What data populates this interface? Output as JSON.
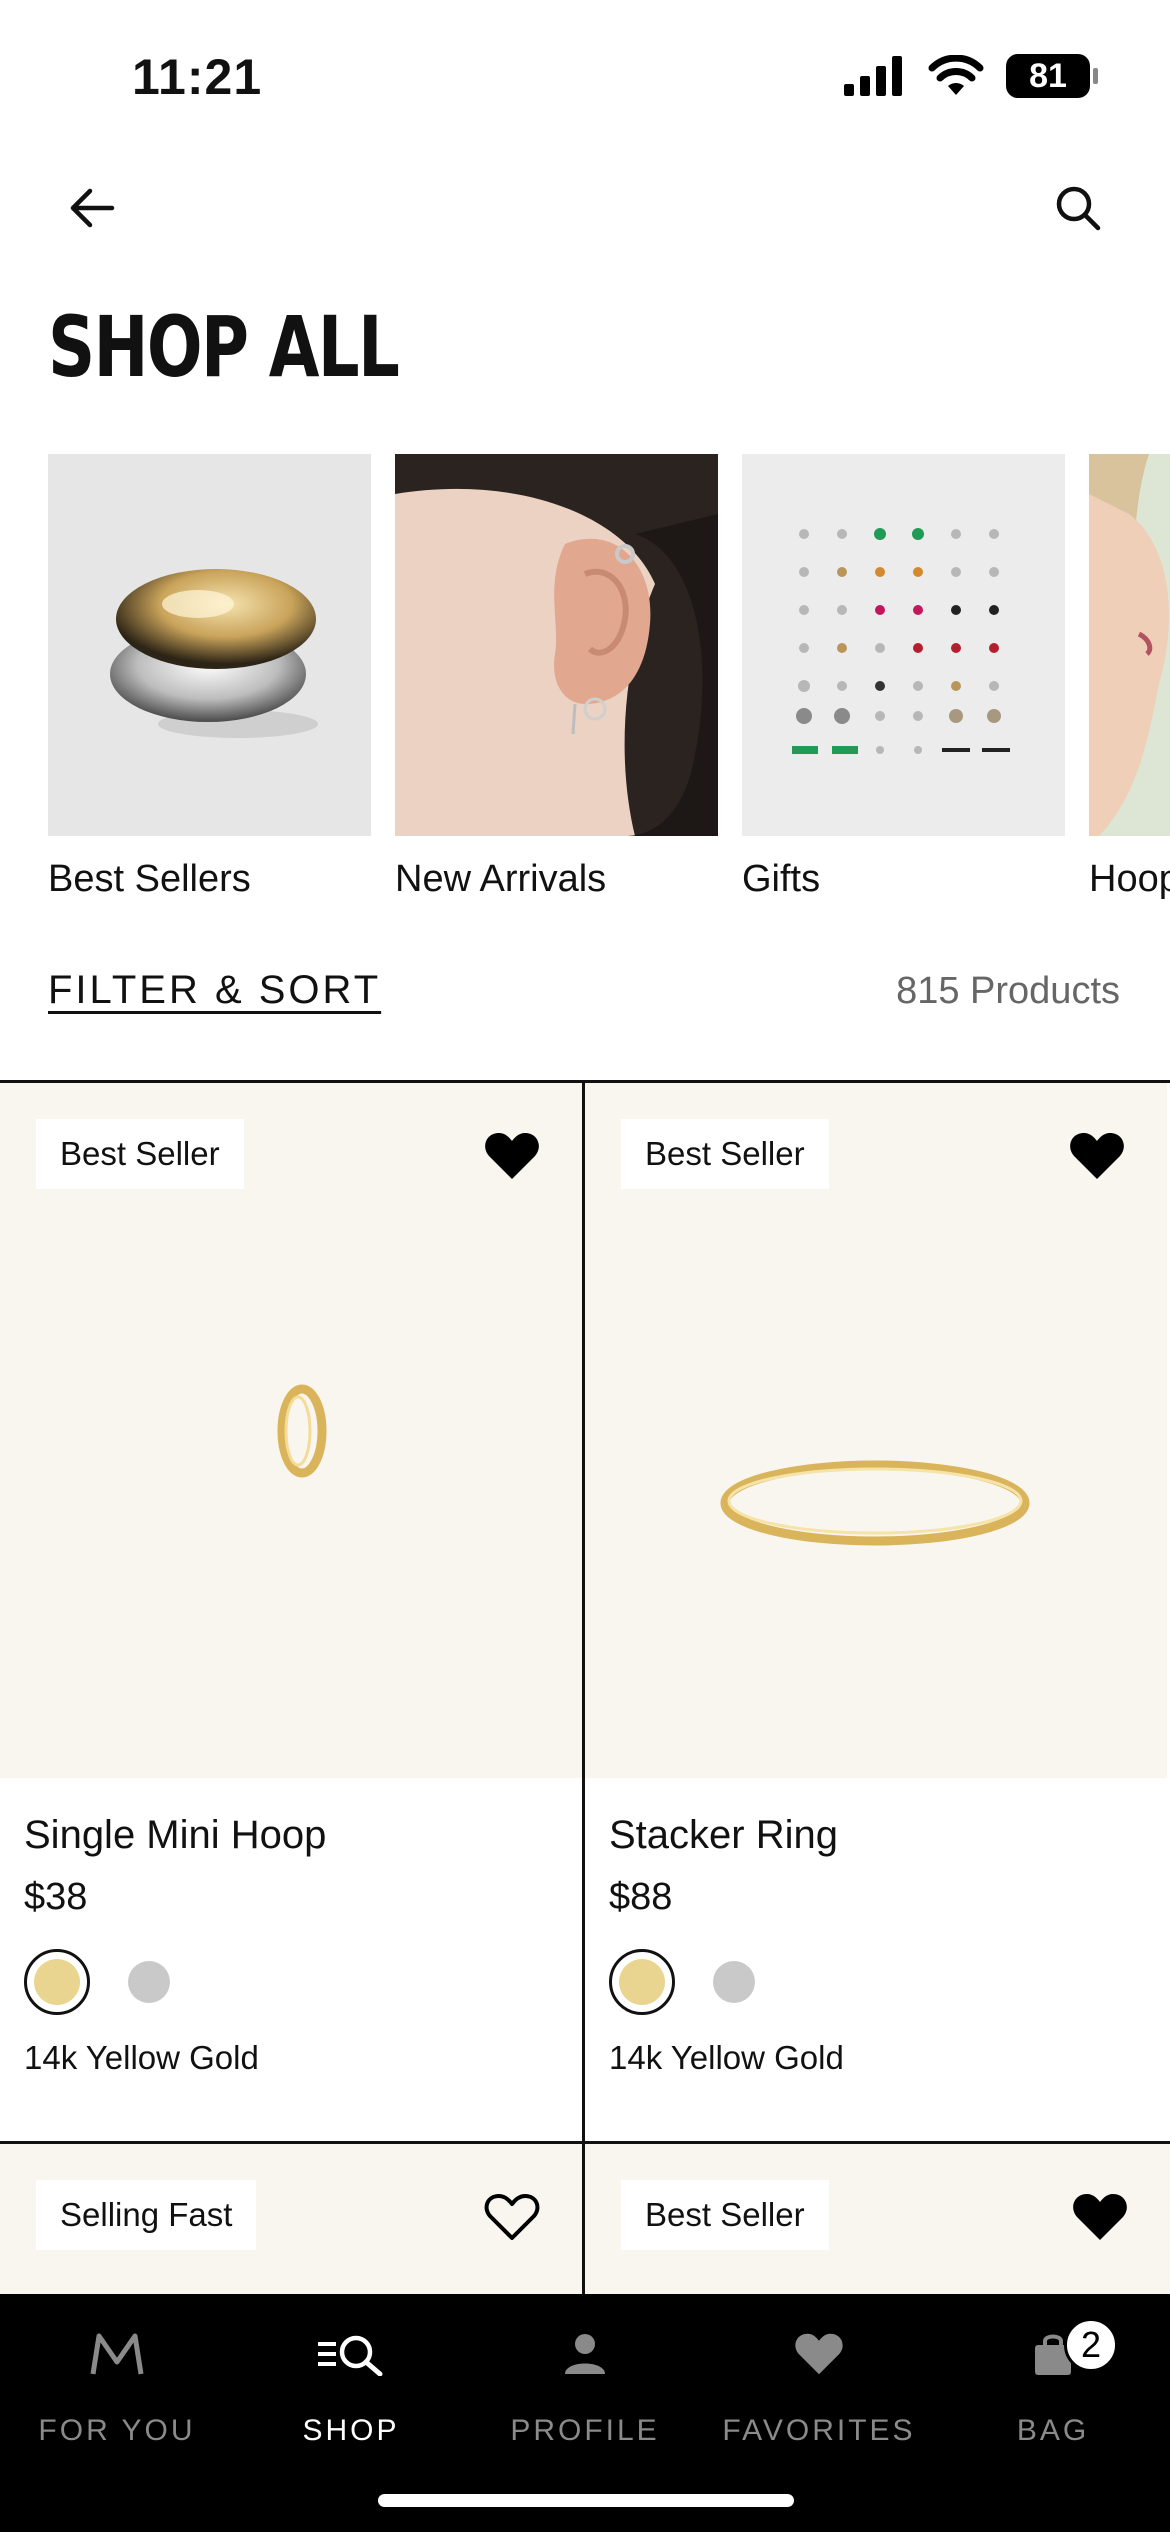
{
  "status": {
    "time": "11:21",
    "battery": "81"
  },
  "header": {
    "title": "SHOP ALL"
  },
  "categories": [
    {
      "label": "Best Sellers"
    },
    {
      "label": "New Arrivals"
    },
    {
      "label": "Gifts"
    },
    {
      "label": "Hoops"
    }
  ],
  "filter": {
    "label": "FILTER & SORT",
    "count": "815 Products"
  },
  "products": [
    {
      "badge": "Best Seller",
      "name": "Single Mini Hoop",
      "price": "$38",
      "variant": "14k Yellow Gold",
      "favorited": true
    },
    {
      "badge": "Best Seller",
      "name": "Stacker Ring",
      "price": "$88",
      "variant": "14k Yellow Gold",
      "favorited": true
    },
    {
      "badge": "Selling Fast",
      "favorited": false
    },
    {
      "badge": "Best Seller",
      "favorited": true
    }
  ],
  "tabs": [
    {
      "label": "FOR YOU",
      "icon": "m-logo-icon"
    },
    {
      "label": "SHOP",
      "icon": "shop-icon"
    },
    {
      "label": "PROFILE",
      "icon": "profile-icon"
    },
    {
      "label": "FAVORITES",
      "icon": "heart-icon"
    },
    {
      "label": "BAG",
      "icon": "bag-icon",
      "badge": "2"
    }
  ],
  "colors": {
    "accent": "#000000",
    "product_bg": "#f8f6ef",
    "gold_swatch": "#ead590",
    "silver_swatch": "#c9c9c9"
  }
}
